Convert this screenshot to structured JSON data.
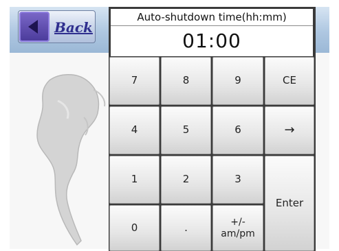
{
  "header": {
    "back_label": "Back"
  },
  "display": {
    "title": "Auto-shutdown time(hh:mm)",
    "value": "01:00"
  },
  "keys": {
    "k7": "7",
    "k8": "8",
    "k9": "9",
    "ce": "CE",
    "k4": "4",
    "k5": "5",
    "k6": "6",
    "arrow": "→",
    "k1": "1",
    "k2": "2",
    "k3": "3",
    "enter": "Enter",
    "k0": "0",
    "dot": ".",
    "plusminus": "+/-",
    "ampm": "am/pm"
  },
  "icons": {
    "back": "back-arrow-icon",
    "map": "world-map-outline"
  },
  "colors": {
    "topbar": "#aec7e1",
    "back_accent": "#5a48b0",
    "keypad_frame": "#3a3a3a"
  }
}
